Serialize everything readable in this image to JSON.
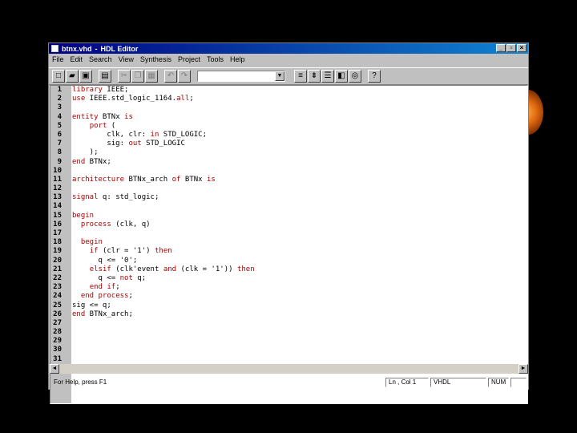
{
  "window": {
    "filename": "btnx.vhd",
    "app_name": "HDL Editor",
    "minimize": "_",
    "maximize": "▫",
    "close": "×"
  },
  "menu": [
    "File",
    "Edit",
    "Search",
    "View",
    "Synthesis",
    "Project",
    "Tools",
    "Help"
  ],
  "toolbar": {
    "combo_value": "",
    "combo_arrow": "▼"
  },
  "editor": {
    "line_numbers": [
      "1",
      "2",
      "3",
      "4",
      "5",
      "6",
      "7",
      "8",
      "9",
      "10",
      "11",
      "12",
      "13",
      "14",
      "15",
      "16",
      "17",
      "18",
      "19",
      "20",
      "21",
      "22",
      "23",
      "24",
      "25",
      "26",
      "27",
      "28",
      "29",
      "30",
      "31"
    ],
    "lines": [
      [
        {
          "t": "kw",
          "s": "library"
        },
        {
          "t": "tx",
          "s": " IEEE;"
        }
      ],
      [
        {
          "t": "kw",
          "s": "use"
        },
        {
          "t": "tx",
          "s": " IEEE.std_logic_1164."
        },
        {
          "t": "kw",
          "s": "all"
        },
        {
          "t": "tx",
          "s": ";"
        }
      ],
      [],
      [
        {
          "t": "kw",
          "s": "entity"
        },
        {
          "t": "tx",
          "s": " BTNx "
        },
        {
          "t": "kw",
          "s": "is"
        }
      ],
      [
        {
          "t": "tx",
          "s": "    "
        },
        {
          "t": "kw",
          "s": "port"
        },
        {
          "t": "tx",
          "s": " ("
        }
      ],
      [
        {
          "t": "tx",
          "s": "        clk, clr: "
        },
        {
          "t": "kw",
          "s": "in"
        },
        {
          "t": "tx",
          "s": " STD_LOGIC;"
        }
      ],
      [
        {
          "t": "tx",
          "s": "        sig: "
        },
        {
          "t": "kw",
          "s": "out"
        },
        {
          "t": "tx",
          "s": " STD_LOGIC"
        }
      ],
      [
        {
          "t": "tx",
          "s": "    );"
        }
      ],
      [
        {
          "t": "kw",
          "s": "end"
        },
        {
          "t": "tx",
          "s": " BTNx;"
        }
      ],
      [],
      [
        {
          "t": "kw",
          "s": "architecture"
        },
        {
          "t": "tx",
          "s": " BTNx_arch "
        },
        {
          "t": "kw",
          "s": "of"
        },
        {
          "t": "tx",
          "s": " BTNx "
        },
        {
          "t": "kw",
          "s": "is"
        }
      ],
      [],
      [
        {
          "t": "kw",
          "s": "signal"
        },
        {
          "t": "tx",
          "s": " q: std_logic;"
        }
      ],
      [],
      [
        {
          "t": "kw",
          "s": "begin"
        }
      ],
      [
        {
          "t": "tx",
          "s": "  "
        },
        {
          "t": "kw",
          "s": "process"
        },
        {
          "t": "tx",
          "s": " (clk, q)"
        }
      ],
      [],
      [
        {
          "t": "tx",
          "s": "  "
        },
        {
          "t": "kw",
          "s": "begin"
        }
      ],
      [
        {
          "t": "tx",
          "s": "    "
        },
        {
          "t": "kw",
          "s": "if"
        },
        {
          "t": "tx",
          "s": " (clr = '1') "
        },
        {
          "t": "kw",
          "s": "then"
        }
      ],
      [
        {
          "t": "tx",
          "s": "      q <= '0';"
        }
      ],
      [
        {
          "t": "tx",
          "s": "    "
        },
        {
          "t": "kw",
          "s": "elsif"
        },
        {
          "t": "tx",
          "s": " (clk'event "
        },
        {
          "t": "kw",
          "s": "and"
        },
        {
          "t": "tx",
          "s": " (clk = '1')) "
        },
        {
          "t": "kw",
          "s": "then"
        }
      ],
      [
        {
          "t": "tx",
          "s": "      q <= "
        },
        {
          "t": "kw",
          "s": "not"
        },
        {
          "t": "tx",
          "s": " q;"
        }
      ],
      [
        {
          "t": "tx",
          "s": "    "
        },
        {
          "t": "kw",
          "s": "end if"
        },
        {
          "t": "tx",
          "s": ";"
        }
      ],
      [
        {
          "t": "tx",
          "s": "  "
        },
        {
          "t": "kw",
          "s": "end process"
        },
        {
          "t": "tx",
          "s": ";"
        }
      ],
      [
        {
          "t": "tx",
          "s": "sig <= q;"
        }
      ],
      [
        {
          "t": "kw",
          "s": "end"
        },
        {
          "t": "tx",
          "s": " BTNx_arch;"
        }
      ],
      [],
      [],
      [],
      [],
      []
    ]
  },
  "scroll": {
    "left": "◄",
    "right": "►"
  },
  "status": {
    "help": "For Help, press F1",
    "position": "Ln , Col 1",
    "language": "VHDL",
    "num": "NUM"
  },
  "colors": {
    "keyword": "#b00000",
    "title_start": "#000080",
    "title_end": "#1084d0"
  }
}
